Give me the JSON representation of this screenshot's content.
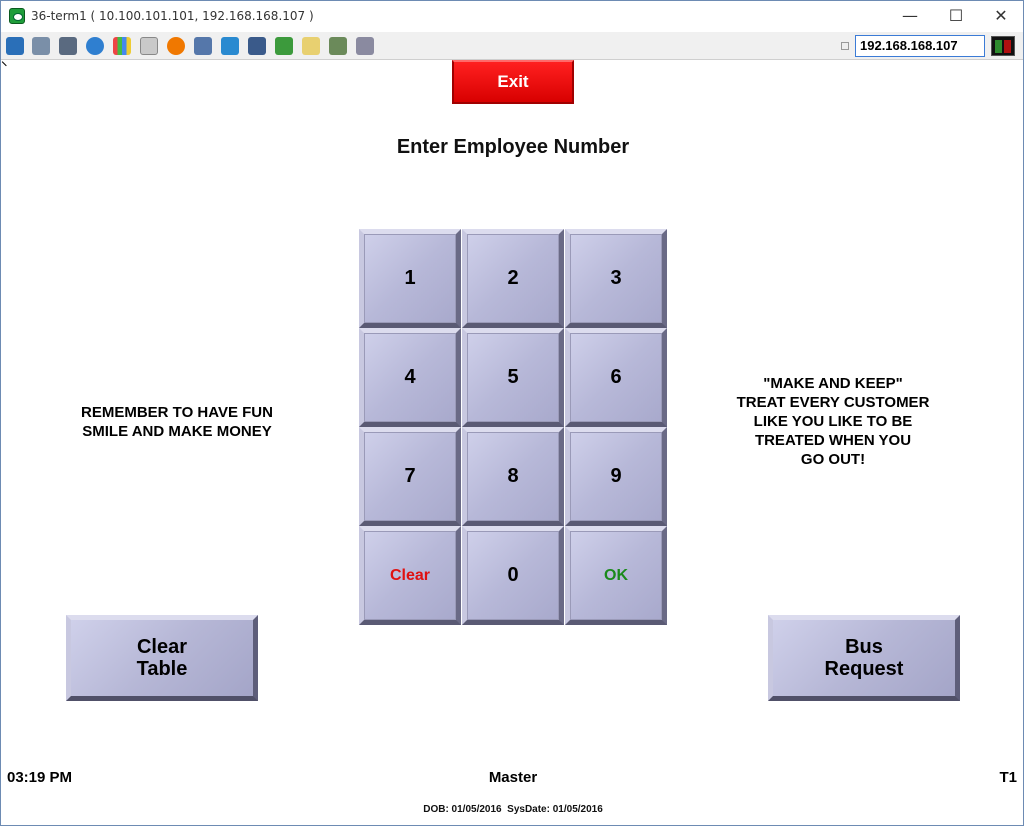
{
  "window": {
    "title": "36-term1 ( 10.100.101.101, 192.168.168.107 )",
    "minimize_label": "—",
    "maximize_label": "☐",
    "close_label": "✕"
  },
  "toolbar": {
    "icons": [
      "monitor-icon",
      "windows-icon",
      "tools-icon",
      "refresh-icon",
      "windows-logo-icon",
      "keyboard-icon",
      "alert-icon",
      "network-disconnect-icon",
      "fullscreen-icon",
      "screen-icon",
      "download-icon",
      "notes-icon",
      "map-icon",
      "chat-icon"
    ],
    "ip_address": "192.168.168.107",
    "colors": {
      "status_green": "#2e8b2e",
      "status_red": "#b01010"
    }
  },
  "main": {
    "exit_label": "Exit",
    "prompt": "Enter Employee Number",
    "left_message": [
      "REMEMBER TO HAVE FUN",
      "SMILE AND MAKE MONEY"
    ],
    "right_message": [
      "\"MAKE AND KEEP\"",
      "TREAT EVERY CUSTOMER",
      "LIKE YOU LIKE TO BE",
      "TREATED WHEN YOU",
      "GO OUT!"
    ],
    "keypad": {
      "keys": [
        "1",
        "2",
        "3",
        "4",
        "5",
        "6",
        "7",
        "8",
        "9",
        "Clear",
        "0",
        "OK"
      ]
    },
    "clear_table_label": [
      "Clear",
      "Table"
    ],
    "bus_request_label": [
      "Bus",
      "Request"
    ]
  },
  "footer": {
    "time": "03:19 PM",
    "mode": "Master",
    "terminal": "T1",
    "dates": "DOB: 01/05/2016  SysDate: 01/05/2016"
  },
  "colors": {
    "exit_red": "#e00000",
    "key_face": "#b7b8d8",
    "clear_text": "#e01010",
    "ok_text": "#1a8a1a"
  }
}
